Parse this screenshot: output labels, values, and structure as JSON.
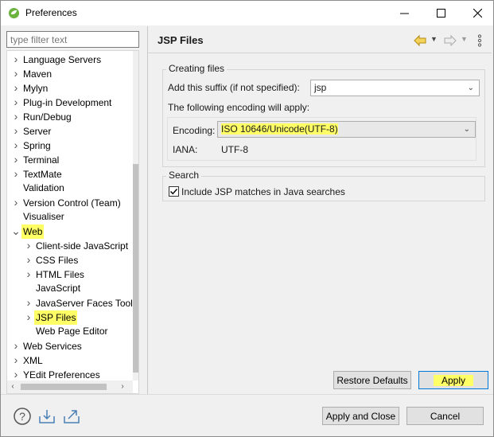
{
  "window": {
    "title": "Preferences",
    "minimize_icon": "minimize-icon",
    "maximize_icon": "maximize-icon",
    "close_icon": "close-icon"
  },
  "filter": {
    "placeholder": "type filter text",
    "value": ""
  },
  "tree": {
    "items": [
      {
        "label": "Language Servers",
        "level": 0,
        "expander": "collapsed"
      },
      {
        "label": "Maven",
        "level": 0,
        "expander": "collapsed"
      },
      {
        "label": "Mylyn",
        "level": 0,
        "expander": "collapsed"
      },
      {
        "label": "Plug-in Development",
        "level": 0,
        "expander": "collapsed"
      },
      {
        "label": "Run/Debug",
        "level": 0,
        "expander": "collapsed"
      },
      {
        "label": "Server",
        "level": 0,
        "expander": "collapsed"
      },
      {
        "label": "Spring",
        "level": 0,
        "expander": "collapsed"
      },
      {
        "label": "Terminal",
        "level": 0,
        "expander": "collapsed"
      },
      {
        "label": "TextMate",
        "level": 0,
        "expander": "collapsed"
      },
      {
        "label": "Validation",
        "level": 0,
        "expander": "none"
      },
      {
        "label": "Version Control (Team)",
        "level": 0,
        "expander": "collapsed"
      },
      {
        "label": "Visualiser",
        "level": 0,
        "expander": "none"
      },
      {
        "label": "Web",
        "level": 0,
        "expander": "expanded",
        "highlighted": true
      },
      {
        "label": "Client-side JavaScript",
        "level": 1,
        "expander": "collapsed"
      },
      {
        "label": "CSS Files",
        "level": 1,
        "expander": "collapsed"
      },
      {
        "label": "HTML Files",
        "level": 1,
        "expander": "collapsed"
      },
      {
        "label": "JavaScript",
        "level": 1,
        "expander": "none"
      },
      {
        "label": "JavaServer Faces Tools",
        "level": 1,
        "expander": "collapsed"
      },
      {
        "label": "JSP Files",
        "level": 1,
        "expander": "collapsed",
        "highlighted": true,
        "selected": true
      },
      {
        "label": "Web Page Editor",
        "level": 1,
        "expander": "none"
      },
      {
        "label": "Web Services",
        "level": 0,
        "expander": "collapsed"
      },
      {
        "label": "XML",
        "level": 0,
        "expander": "collapsed"
      },
      {
        "label": "YEdit Preferences",
        "level": 0,
        "expander": "collapsed"
      }
    ]
  },
  "page": {
    "title": "JSP Files",
    "back_icon": "back-arrow-icon",
    "forward_icon": "forward-arrow-icon",
    "menu_icon": "view-menu-icon"
  },
  "creating_files": {
    "legend": "Creating files",
    "suffix_label": "Add this suffix (if not specified):",
    "suffix_value": "jsp",
    "encoding_note": "The following encoding will apply:",
    "encoding_label": "Encoding:",
    "encoding_value": "ISO 10646/Unicode(UTF-8)",
    "iana_label": "IANA:",
    "iana_value": "UTF-8"
  },
  "search": {
    "legend": "Search",
    "checkbox_label": "Include JSP matches in Java searches",
    "checked": true
  },
  "buttons": {
    "restore_defaults": "Restore Defaults",
    "apply": "Apply",
    "apply_and_close": "Apply and Close",
    "cancel": "Cancel"
  },
  "bottom_icons": [
    "help-icon",
    "import-icon",
    "export-icon"
  ],
  "colors": {
    "highlight": "#ffff66",
    "accent": "#0078d7"
  }
}
